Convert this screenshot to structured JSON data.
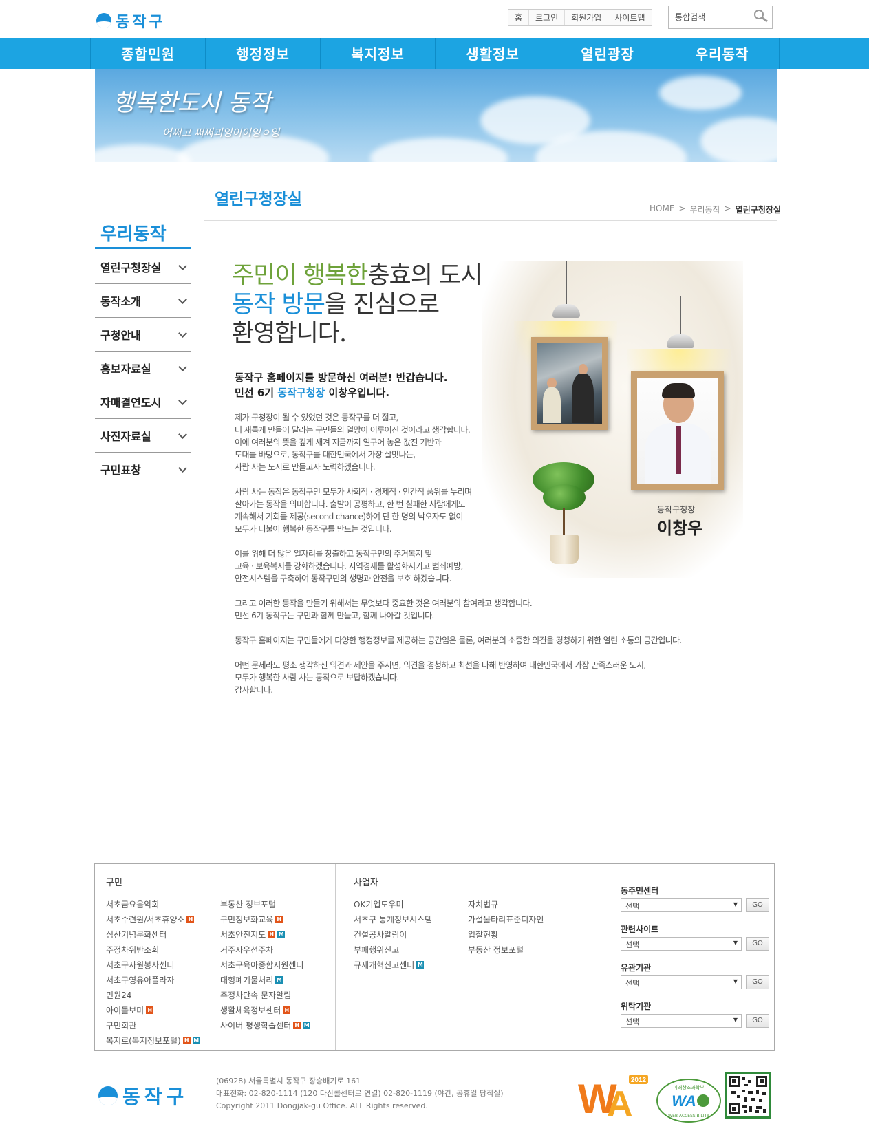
{
  "header": {
    "logo_text": "동작구",
    "util_links": [
      "홈",
      "로그인",
      "회원가입",
      "사이트맵"
    ],
    "search_placeholder": "통합검색"
  },
  "gnb": [
    "종합민원",
    "행정정보",
    "복지정보",
    "생활정보",
    "열린광장",
    "우리동작"
  ],
  "banner": {
    "title": "행복한도시 동작",
    "subtitle": "어쩌고 쩌쩌괴잉이이잉ㅇ잉"
  },
  "content": {
    "page_title": "열린구청장실",
    "breadcrumb": [
      "HOME",
      ">",
      "우리동작",
      ">",
      "열린구청장실"
    ]
  },
  "sidebar": {
    "title": "우리동작",
    "items": [
      "열린구청장실",
      "동작소개",
      "구청안내",
      "홍보자료실",
      "자매결연도시",
      "사진자료실",
      "구민표창"
    ]
  },
  "greeting": {
    "headline_1a": "주민이 행복한",
    "headline_1b": "충효의 도시",
    "headline_2a": "동작 방문",
    "headline_2b": "을 진심으로",
    "headline_3": "환영합니다.",
    "intro_1": "동작구 홈페이지를 방문하신 여러분! 반갑습니다.",
    "intro_2a": "민선 6기 ",
    "intro_2b": "동작구청장",
    "intro_2c": " 이창우입니다.",
    "mayor_role": "동작구청장",
    "mayor_name": "이창우",
    "paragraphs": [
      [
        "제가 구청장이 될 수 있었던 것은 동작구를 더 젊고,",
        "더 새롭게 만들어 달라는 구민들의 열망이 이루어진 것이라고 생각합니다.",
        "이에 여러분의 뜻을 깊게 새겨 지금까지 일구어 놓은 값진 기반과",
        "토대를 바탕으로, 동작구를 대한민국에서 가장 살맛나는,",
        "사람 사는 도시로 만들고자 노력하겠습니다."
      ],
      [
        "사람 사는 동작은 동작구민 모두가 사회적 · 경제적 · 인간적 품위를 누리며",
        "살아가는 동작을 의미합니다. 출발이 공평하고, 한 번 실패한 사람에게도",
        "계속해서 기회를 제공(second chance)하여 단 한 명의 낙오자도 없이",
        "모두가 더불어 행복한 동작구를 만드는 것입니다."
      ],
      [
        "이를 위해 더 많은 일자리를 창출하고 동작구민의 주거복지 및",
        "교육 · 보육복지를 강화하겠습니다. 지역경제를 활성화시키고 범죄예방,",
        "안전시스템을 구축하여 동작구민의 생명과 안전을 보호 하겠습니다."
      ],
      [
        "그리고 이러한 동작을 만들기 위해서는 무엇보다 중요한 것은 여러분의 참여라고 생각합니다.",
        "민선 6기 동작구는 구민과 함께 만들고, 함께 나아갈 것입니다."
      ],
      [
        "동작구 홈페이지는 구민들에게 다양한 행정정보를 제공하는 공간임은 물론, 여러분의 소중한 의견을 경청하기 위한 열린 소통의 공간입니다."
      ],
      [
        "어떤 문제라도 평소 생각하신 의견과 제안을 주시면, 의견을 경청하고 최선을 다해 반영하여 대한민국에서 가장 만족스러운 도시,",
        "모두가 행복한 사람 사는 동작으로 보답하겠습니다.",
        "감사합니다."
      ]
    ]
  },
  "footer_links": {
    "citizen_title": "구민",
    "citizen_col1": [
      "서초금요음악회",
      "서초수련원/서초휴양소",
      "심산기념문화센터",
      "주정차위반조회",
      "서초구자원봉사센터",
      "서초구영유아플라자",
      "민원24",
      "아이돌보미",
      "구민회관",
      "복지로(복지정보포털)"
    ],
    "citizen_col2": [
      "부동산 정보포털",
      "구민정보화교육",
      "서초안전지도",
      "거주자우선주차",
      "서초구육아종합지원센터",
      "대형폐기물처리",
      "주정차단속 문자알림",
      "생활체육정보센터",
      "사이버 평생학습센터"
    ],
    "business_title": "사업자",
    "business_col1": [
      "OK기업도우미",
      "서초구 통계정보시스템",
      "건설공사알림이",
      "부패행위신고",
      "규제개혁신고센터"
    ],
    "business_col2": [
      "자치법규",
      "가설울타리표준디자인",
      "입찰현황",
      "부동산 정보포털"
    ],
    "selects": [
      {
        "label": "동주민센터",
        "value": "선택",
        "button": "GO"
      },
      {
        "label": "관련사이트",
        "value": "선택",
        "button": "GO"
      },
      {
        "label": "유관기관",
        "value": "선택",
        "button": "GO"
      },
      {
        "label": "위탁기관",
        "value": "선택",
        "button": "GO"
      }
    ]
  },
  "footer": {
    "logo_text": "동작구",
    "address": "(06928) 서울특별시 동작구 장승배기로 161",
    "phone": "대표전화: 02-820-1114 (120 다산콜센터로 연결) 02-820-1119 (야간, 공휴일 당직실)",
    "copyright": "Copyright 2011 Dongjak-gu Office. ALL Rights reserved.",
    "wa_year": "2012",
    "wa_cert_top": "미래창조과학부",
    "wa_cert_bottom": "WEB ACCESSIBILITY"
  },
  "colors": {
    "brand_blue": "#1ca4e2",
    "accent_green": "#6ea23a",
    "frame_wood": "#c9a170"
  }
}
